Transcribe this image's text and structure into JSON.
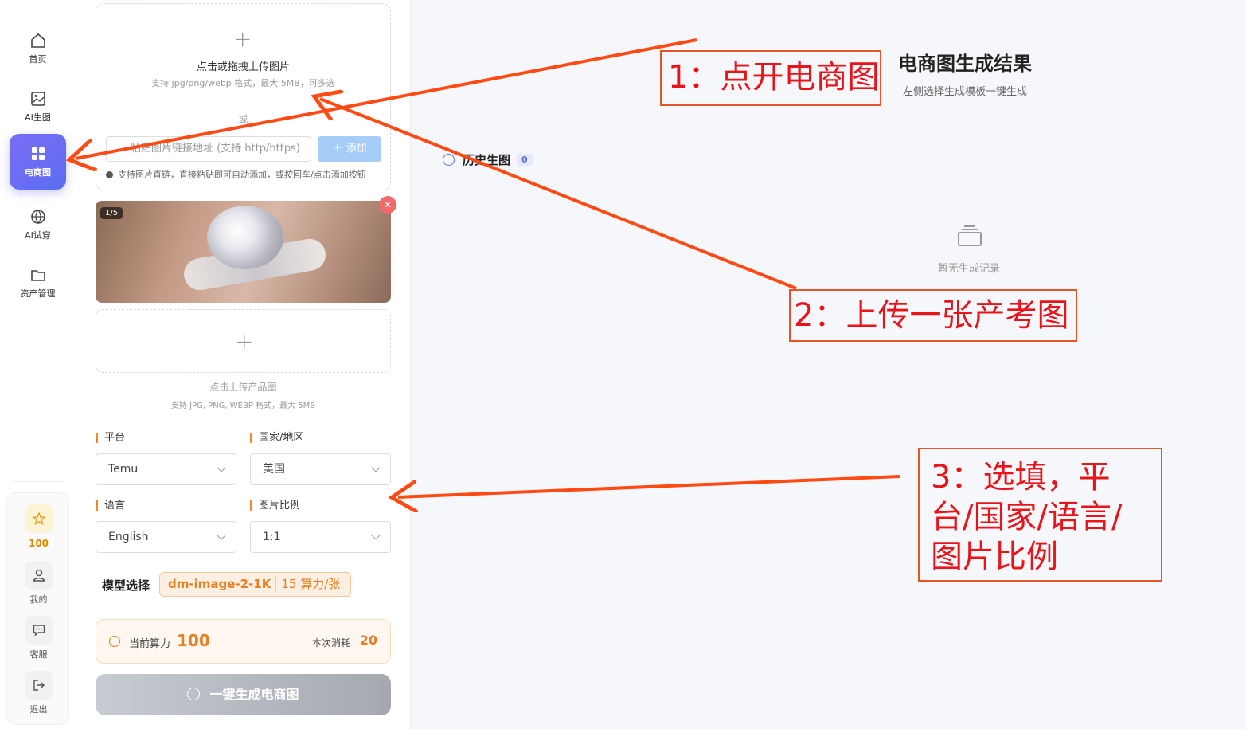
{
  "nav": {
    "items": [
      {
        "label": "首页",
        "icon": "home-icon"
      },
      {
        "label": "AI生图",
        "icon": "image-icon"
      },
      {
        "label": "电商图",
        "icon": "grid-icon",
        "active": true
      },
      {
        "label": "AI试穿",
        "icon": "ball-icon"
      },
      {
        "label": "资产管理",
        "icon": "folder-icon"
      }
    ],
    "bottom": {
      "credits": "100",
      "mine": "我的",
      "service": "客服",
      "logout": "退出"
    }
  },
  "upload": {
    "title": "点击或拖拽上传图片",
    "subtitle": "支持 jpg/png/webp 格式，最大 5MB，可多选",
    "or": "或",
    "url_placeholder": "粘贴图片链接地址 (支持 http/https)",
    "add_button": "添加",
    "hint": "支持图片直链，直接粘贴即可自动添加，或按回车/点击添加按钮"
  },
  "image_card": {
    "badge": "1/5"
  },
  "product": {
    "title": "点击上传产品图",
    "subtitle": "支持 JPG, PNG, WEBP 格式，最大 5MB"
  },
  "form": {
    "platform_label": "平台",
    "platform_value": "Temu",
    "country_label": "国家/地区",
    "country_value": "美国",
    "language_label": "语言",
    "language_value": "English",
    "ratio_label": "图片比例",
    "ratio_value": "1:1"
  },
  "model": {
    "label": "模型选择",
    "name": "dm-image-2-1K",
    "cost": "15 算力/张"
  },
  "credits": {
    "current_label": "当前算力",
    "current_value": "100",
    "cost_label": "本次消耗",
    "cost_value": "20"
  },
  "generate_button": "一键生成电商图",
  "result": {
    "title": "电商图生成结果",
    "subtitle": "左侧选择生成模板一键生成",
    "history_label": "历史生图",
    "history_count": "0",
    "empty_text": "暂无生成记录"
  },
  "annotations": {
    "step1": "1：点开电商图",
    "step2": "2：上传一张产考图",
    "step3": "3：选填，平台/国家/语言/图片比例"
  },
  "colors": {
    "accent": "#5a6ef0",
    "orange": "#e67e22",
    "annotation_red": "#e8141a"
  }
}
